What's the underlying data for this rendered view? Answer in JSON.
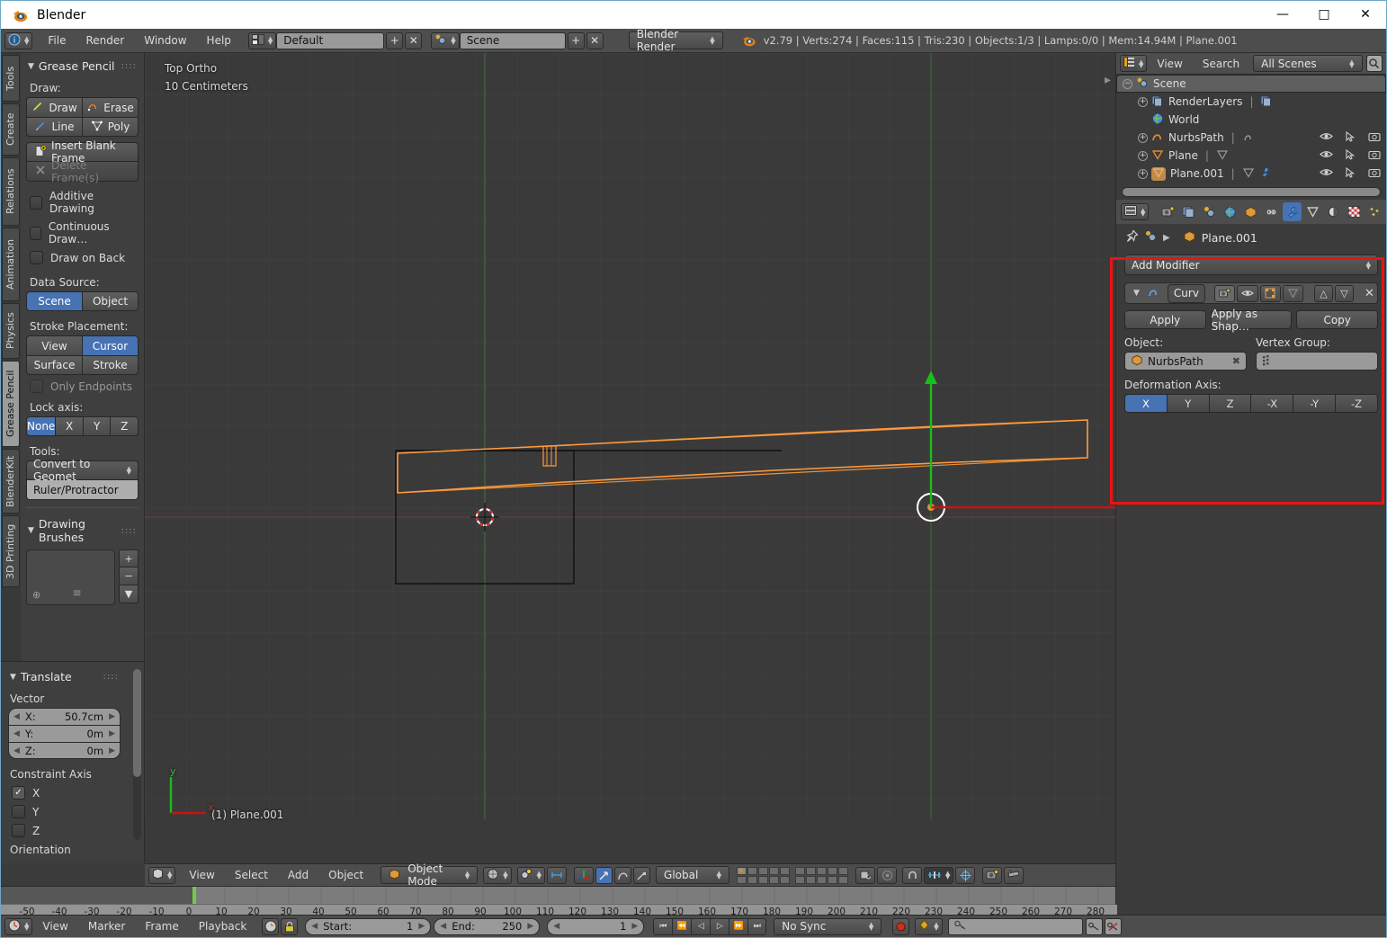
{
  "window": {
    "title": "Blender",
    "app_icon": "blender-logo-icon",
    "minimize": "—",
    "maximize": "□",
    "close": "✕"
  },
  "topbar": {
    "editor_icon": "info-editor-icon",
    "menus": [
      "File",
      "Render",
      "Window",
      "Help"
    ],
    "screen_layout": {
      "icon": "screen-layout-icon",
      "value": "Default",
      "add": "+",
      "remove": "✕"
    },
    "scene": {
      "icon": "scene-icon",
      "value": "Scene",
      "add": "+",
      "remove": "✕"
    },
    "engine": {
      "value": "Blender Render"
    },
    "status": "v2.79 | Verts:274 | Faces:115 | Tris:230 | Objects:1/3 | Lamps:0/0 | Mem:14.94M | Plane.001"
  },
  "toolshelf": {
    "tabs": [
      "Tools",
      "Create",
      "Relations",
      "Animation",
      "Physics",
      "Grease Pencil",
      "BlenderKit",
      "3D Printing"
    ],
    "active_tab": "Grease Pencil",
    "panel_title": "Grease Pencil",
    "draw_label": "Draw:",
    "draw_buttons": [
      "Draw",
      "Erase",
      "Line",
      "Poly"
    ],
    "insert_blank_frame": "Insert Blank Frame",
    "delete_frames": "Delete Frame(s)",
    "checkboxes": [
      {
        "label": "Additive Drawing",
        "checked": false
      },
      {
        "label": "Continuous Draw…",
        "checked": false
      },
      {
        "label": "Draw on Back",
        "checked": false
      }
    ],
    "data_source_label": "Data Source:",
    "data_source": {
      "options": [
        "Scene",
        "Object"
      ],
      "active": "Scene"
    },
    "stroke_placement_label": "Stroke Placement:",
    "stroke_placement": {
      "options": [
        "View",
        "Cursor",
        "Surface",
        "Stroke"
      ],
      "active": "Cursor"
    },
    "only_endpoints": {
      "label": "Only Endpoints",
      "checked": false
    },
    "lock_axis_label": "Lock axis:",
    "lock_axis": {
      "options": [
        "None",
        "X",
        "Y",
        "Z"
      ],
      "active": "None"
    },
    "tools_label": "Tools:",
    "tools_selected": "Convert to Geomet",
    "tools_second": "Ruler/Protractor",
    "brushes_title": "Drawing Brushes",
    "brush_add": "+",
    "brush_remove": "−",
    "brush_menu": "▼"
  },
  "operator_panel": {
    "title": "Translate",
    "vector_label": "Vector",
    "vector": [
      {
        "label": "X:",
        "value": "50.7cm"
      },
      {
        "label": "Y:",
        "value": "0m"
      },
      {
        "label": "Z:",
        "value": "0m"
      }
    ],
    "constraint_label": "Constraint Axis",
    "constraints": [
      {
        "label": "X",
        "checked": true
      },
      {
        "label": "Y",
        "checked": false
      },
      {
        "label": "Z",
        "checked": false
      }
    ],
    "orientation_label": "Orientation"
  },
  "viewport": {
    "view_name": "Top Ortho",
    "grid_scale": "10 Centimeters",
    "object_label": "(1) Plane.001",
    "axis_x": "x",
    "axis_y": "y",
    "header": {
      "editor_icon": "3d-view-editor-icon",
      "menus": [
        "View",
        "Select",
        "Add",
        "Object"
      ],
      "mode": "Object Mode",
      "viewport_shading": "solid-shade-icon",
      "pivot": "pivot-icon",
      "snap_to": "snap-magnet-icon",
      "transform_orientation": "Global",
      "manipulators": [
        "translate-manipulator-icon",
        "rotate-manipulator-icon",
        "scale-manipulator-icon"
      ],
      "layers_label": "scene-layers",
      "extras": [
        "render-preview-icon",
        "render-opengl-icon"
      ]
    },
    "colors": {
      "object_selected": "#ff9a3c",
      "object_unselected": "#000000",
      "axis_y_line": "#4a9c3c",
      "axis_x_line": "#9c3c3c",
      "manipulator_x": "#cc2222",
      "manipulator_y": "#22cc22"
    }
  },
  "outliner": {
    "editor_icon": "outliner-editor-icon",
    "menus": [
      "View",
      "Search"
    ],
    "display_mode": "All Scenes",
    "filter_icon": "search-icon",
    "rows": [
      {
        "name": "Scene",
        "icon": "scene-icon",
        "indent": 0,
        "expander": "−",
        "selected": true,
        "restrict": false
      },
      {
        "name": "RenderLayers",
        "icon": "renderlayers-icon",
        "indent": 1,
        "expander": "+",
        "selected": false,
        "restrict": false,
        "extra_icon": "renderlayer-data-icon"
      },
      {
        "name": "World",
        "icon": "world-icon",
        "indent": 1,
        "expander": "",
        "selected": false,
        "restrict": false
      },
      {
        "name": "NurbsPath",
        "icon": "curve-icon",
        "indent": 1,
        "expander": "+",
        "selected": false,
        "restrict": true,
        "extra_icon": "curve-data-icon"
      },
      {
        "name": "Plane",
        "icon": "mesh-icon",
        "indent": 1,
        "expander": "+",
        "selected": false,
        "restrict": true,
        "extra_icon": "mesh-data-icon"
      },
      {
        "name": "Plane.001",
        "icon": "mesh-icon",
        "indent": 1,
        "expander": "+",
        "selected": false,
        "restrict": true,
        "extra_icon": "mesh-data-icon",
        "modifier_icon": "wrench-icon"
      }
    ],
    "restrict_icons": [
      "eye-icon",
      "cursor-arrow-icon",
      "camera-icon"
    ]
  },
  "properties": {
    "editor_icon": "properties-editor-icon",
    "tabs": [
      "render-icon",
      "render-layers-icon",
      "scene-icon",
      "world-icon",
      "object-icon",
      "constraints-icon",
      "wrench-icon",
      "data-icon",
      "material-icon",
      "texture-icon",
      "particles-icon",
      "physics-icon"
    ],
    "active_tab": "wrench-icon",
    "breadcrumb": {
      "pin_icon": "pin-icon",
      "scene_icon": "scene-icon",
      "object_icon": "object-icon",
      "object_name": "Plane.001"
    },
    "add_modifier": "Add Modifier",
    "modifier": {
      "expand_icon": "triangle-down-icon",
      "type_icon": "curve-modifier-icon",
      "name": "Curv",
      "toggles": [
        "render-icon",
        "realtime-eye-icon",
        "edit-mode-icon",
        "cage-icon"
      ],
      "move_up": "△",
      "move_down": "▽",
      "delete": "✕",
      "buttons": [
        "Apply",
        "Apply as Shap…",
        "Copy"
      ],
      "object_label": "Object:",
      "object_value": "NurbsPath",
      "object_clear": "✖",
      "vertex_group_label": "Vertex Group:",
      "vertex_group_value": "",
      "vertex_group_icon": "vertex-group-icon",
      "deformation_axis_label": "Deformation Axis:",
      "deformation_axis": {
        "options": [
          "X",
          "Y",
          "Z",
          "-X",
          "-Y",
          "-Z"
        ],
        "active": "X"
      }
    },
    "highlight_color": "#ee1111"
  },
  "timeline": {
    "editor_icon": "timeline-editor-icon",
    "menus": [
      "View",
      "Marker",
      "Frame",
      "Playback"
    ],
    "auto_key_icon": "record-clock-icon",
    "lock_icon": "lock-icon",
    "start": {
      "label": "Start:",
      "value": "1"
    },
    "end": {
      "label": "End:",
      "value": "250"
    },
    "current_frame": "1",
    "transport": [
      "⏮",
      "⏪",
      "◁",
      "▷",
      "⏩",
      "⏭"
    ],
    "sync_mode": "No Sync",
    "record_icon": "record-icon",
    "keying_set_icon": "keyframe-diamond-icon",
    "keying_field_icon": "key-icon",
    "keying_field_value": "",
    "insert_key_icon": "add-key-icon",
    "delete_key_icon": "remove-key-icon",
    "ruler_ticks": [
      "-50",
      "-40",
      "-30",
      "-20",
      "-10",
      "0",
      "10",
      "20",
      "30",
      "40",
      "50",
      "60",
      "70",
      "80",
      "90",
      "100",
      "110",
      "120",
      "130",
      "140",
      "150",
      "160",
      "170",
      "180",
      "190",
      "200",
      "210",
      "220",
      "230",
      "240",
      "250",
      "260",
      "270",
      "280"
    ],
    "playhead_frame": 1,
    "playhead_color": "#6ece4a"
  }
}
